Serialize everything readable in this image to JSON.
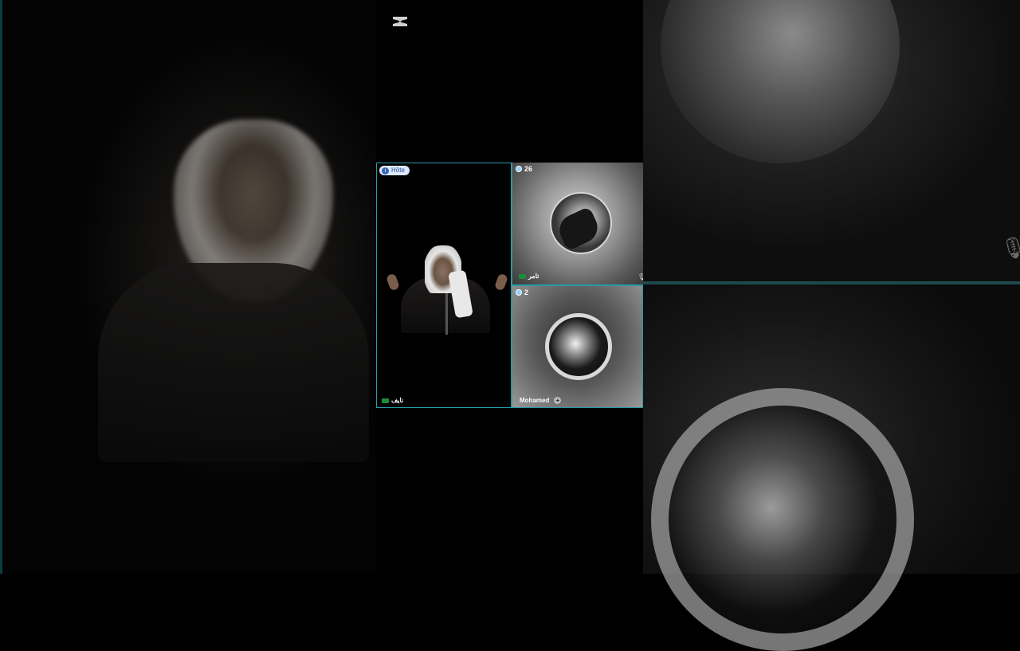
{
  "app": {
    "logo_icon": "capcut-logo-icon"
  },
  "host_tile": {
    "badge_label": "Hôte",
    "badge_icon": "host-icon",
    "name": "نايف",
    "flag_icon": "saudi-flag-icon"
  },
  "guest_tiles": [
    {
      "count": "26",
      "count_icon": "viewer-dot-icon",
      "name": "تامر",
      "flag_icon": "saudi-flag-icon",
      "mute_icon": "mic-muted-icon"
    },
    {
      "count": "2",
      "count_icon": "viewer-dot-icon",
      "name": "Mohamed",
      "action_icon": "plus-icon",
      "action_label": "+"
    }
  ],
  "colors": {
    "accent_border": "#2a9aa6",
    "badge_bg": "#dce9ff",
    "flag_green": "#1e8a3c"
  }
}
